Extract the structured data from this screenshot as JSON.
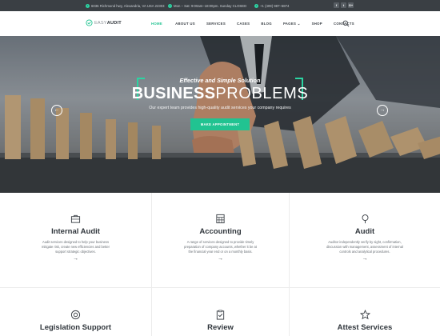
{
  "topbar": {
    "address": "6036 Richmond hwy, Alexandria, VA USA 22303",
    "hours": "Mon – Sat: 9:00am–18:00pm. Sunday CLOSED",
    "phone": "+1 (409) 987–5874",
    "socials": [
      "f",
      "t",
      "G+"
    ]
  },
  "brand": {
    "logo_light": "EASY",
    "logo_bold": "AUDIT"
  },
  "nav": {
    "items": [
      "HOME",
      "ABOUT US",
      "SERVICES",
      "CASES",
      "BLOG",
      "PAGES",
      "SHOP",
      "CONTACTS"
    ],
    "active": "HOME"
  },
  "hero": {
    "subtitle": "Effective and Simple Solution",
    "title_bold": "BUSINESS",
    "title_light": "PROBLEMS",
    "description": "Our expert team provides high-quality audit services your company requires",
    "button": "MAKE APPOINTMENT",
    "prev_arrow": "←",
    "next_arrow": "→"
  },
  "services": [
    {
      "title": "Internal Audit",
      "icon": "briefcase-icon",
      "description": "Audit services designed to help your business mitigate risk, create new efficiencies and better support strategic objectives.",
      "arrow": "→"
    },
    {
      "title": "Accounting",
      "icon": "calculator-icon",
      "description": "A range of services designed to provide timely preparation of company accounts, whether it be at the financial year end or on a monthly basis.",
      "arrow": "→"
    },
    {
      "title": "Audit",
      "icon": "magnifier-icon",
      "description": "Auditor independently verify by sight, confirmation, discussion with management, assessment of internal controls and analytical procedures.",
      "arrow": "→"
    },
    {
      "title": "Legislation Support",
      "icon": "lifebuoy-icon"
    },
    {
      "title": "Review",
      "icon": "clipboard-check-icon"
    },
    {
      "title": "Attest Services",
      "icon": "star-icon"
    }
  ],
  "colors": {
    "accent": "#21c391",
    "topbar": "#3a3f44",
    "text": "#30363c"
  }
}
